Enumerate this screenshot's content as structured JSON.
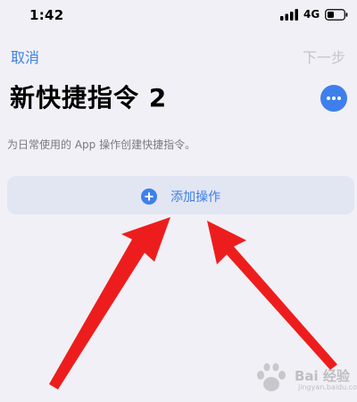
{
  "status_bar": {
    "time": "1:42",
    "network": "4G",
    "signal_icon": "signal-bars-icon",
    "battery_icon": "battery-icon"
  },
  "nav": {
    "cancel_label": "取消",
    "next_label": "下一步"
  },
  "title": "新快捷指令 2",
  "more_icon": "ellipsis-icon",
  "description": "为日常使用的 App 操作创建快捷指令。",
  "add_action": {
    "label": "添加操作",
    "icon": "plus-circle-icon"
  },
  "annotation": {
    "color": "#ee1d1d"
  },
  "watermark": {
    "text": "Bai 经验",
    "sub": "jingyan.baidu.com"
  },
  "colors": {
    "accent": "#3d82e6",
    "background": "#f1f0f6",
    "disabled": "#c5c5ca"
  }
}
